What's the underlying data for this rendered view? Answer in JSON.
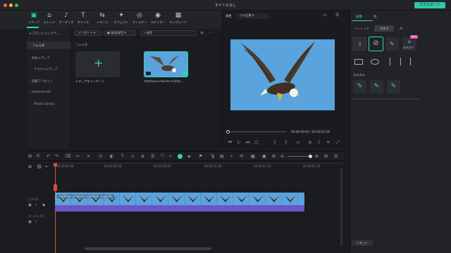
{
  "window": {
    "title": "タイトルなし",
    "export_label": "エクスポート"
  },
  "toolbar": [
    {
      "label": "メディア",
      "icon": "▣"
    },
    {
      "label": "ストック",
      "icon": "⌂"
    },
    {
      "label": "オーディオ",
      "icon": "♪"
    },
    {
      "label": "タイトル",
      "icon": "T"
    },
    {
      "label": "トランジ",
      "icon": "⇆"
    },
    {
      "label": "エフェクト",
      "icon": "✦"
    },
    {
      "label": "フィルター",
      "icon": "◎"
    },
    {
      "label": "ステッカー",
      "icon": "◉"
    },
    {
      "label": "テンプレート",
      "icon": "▦"
    }
  ],
  "sidebar": {
    "items": [
      "プロジェクトメディ..",
      "フォルダ",
      "共有メディア",
      "クラウドメディア",
      "調整プリセット",
      "Influence Kit",
      "Pinkie Library"
    ]
  },
  "media": {
    "import_label": "インポート",
    "record_label": "録画/録音",
    "search_placeholder": "検索",
    "folder_label": "フォルダ",
    "import_tile_label": "メディアをインポート",
    "clip_label": "matthew-schwartz-d.8o9o..."
  },
  "preview": {
    "tab": "再生",
    "quality": "フル品質",
    "time_current": "00:00:00:00",
    "time_total": "00:00:01:00"
  },
  "right_panel": {
    "tabs": [
      "画像",
      "色"
    ],
    "subtabs": [
      "ベーシック",
      "マスク",
      "AI"
    ],
    "ai_mask_label": "AIマスク",
    "new_badge": "NEW",
    "custom_label": "カスタム",
    "reset_label": "リセット"
  },
  "timeline": {
    "ruler": [
      "00:00:00:00",
      "00:00:00:10",
      "00:00:00:20",
      "00:00:01:00",
      "00:00:01:10",
      "00:00:01:20"
    ],
    "track_video": "ビデオ1",
    "track_audio": "オーディオ1",
    "clip_name": "matthew-schwartz-d.8o9o0o-unsplash"
  },
  "colors": {
    "accent": "#2fd5b2",
    "clip": "#6b55c7",
    "sky": "#5aa3dc"
  }
}
